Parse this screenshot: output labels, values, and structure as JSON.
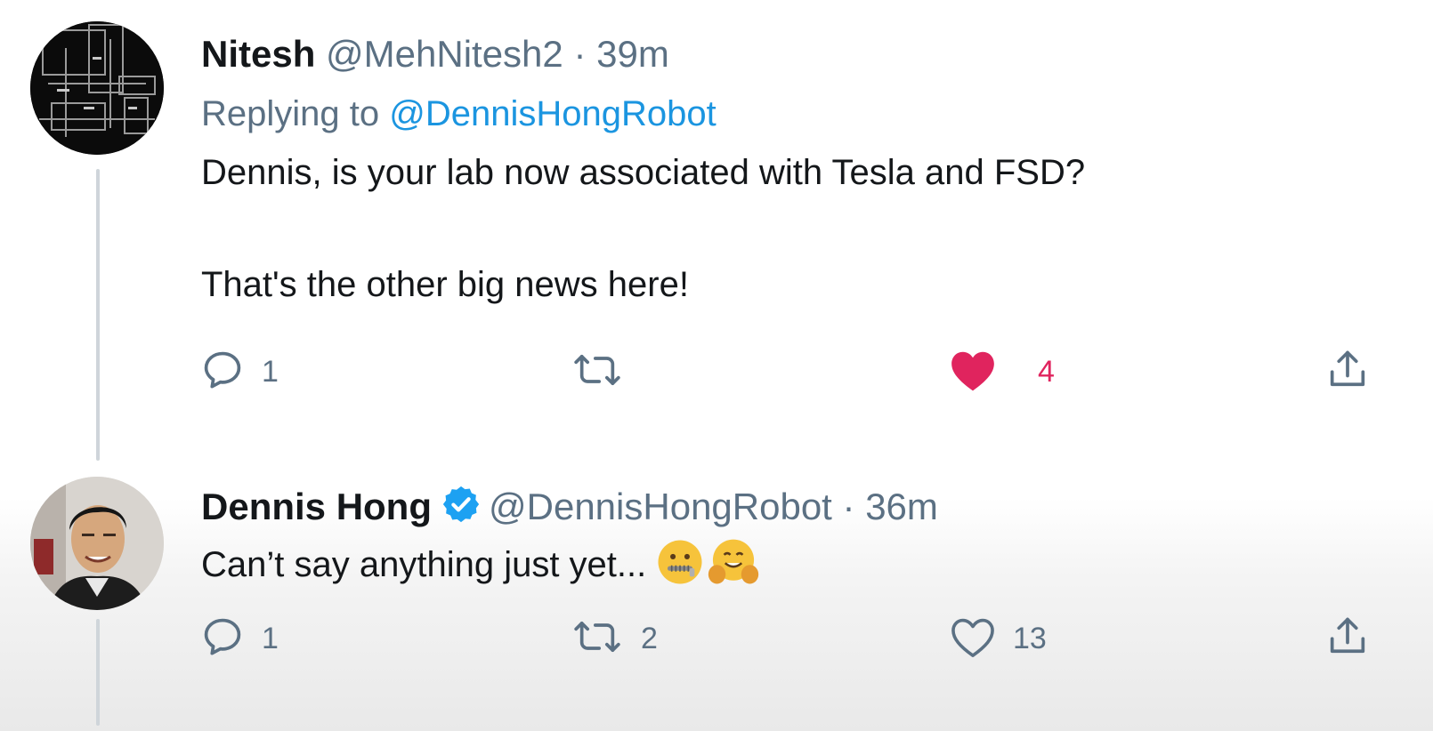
{
  "tweets": [
    {
      "name": "Nitesh",
      "handle": "@MehNitesh2",
      "separator": "·",
      "time": "39m",
      "replying_prefix": "Replying to",
      "replying_to": "@DennisHongRobot",
      "lines": [
        "Dennis, is your lab now associated with Tesla and FSD?",
        "That's the other big news here!"
      ],
      "reply_count": "1",
      "retweet_count": "",
      "like_count": "4",
      "liked": true,
      "like_color": "#e0245e"
    },
    {
      "name": "Dennis Hong",
      "verified": true,
      "handle": "@DennisHongRobot",
      "separator": "·",
      "time": "36m",
      "lines": [
        "Can’t say anything just yet..."
      ],
      "emojis": [
        "zipper-mouth-face",
        "hugging-face"
      ],
      "reply_count": "1",
      "retweet_count": "2",
      "like_count": "13",
      "liked": false
    }
  ],
  "colors": {
    "text": "#14171a",
    "secondary": "#5b7083",
    "link": "#1b95e0",
    "verified": "#1da1f2",
    "like": "#e0245e"
  }
}
